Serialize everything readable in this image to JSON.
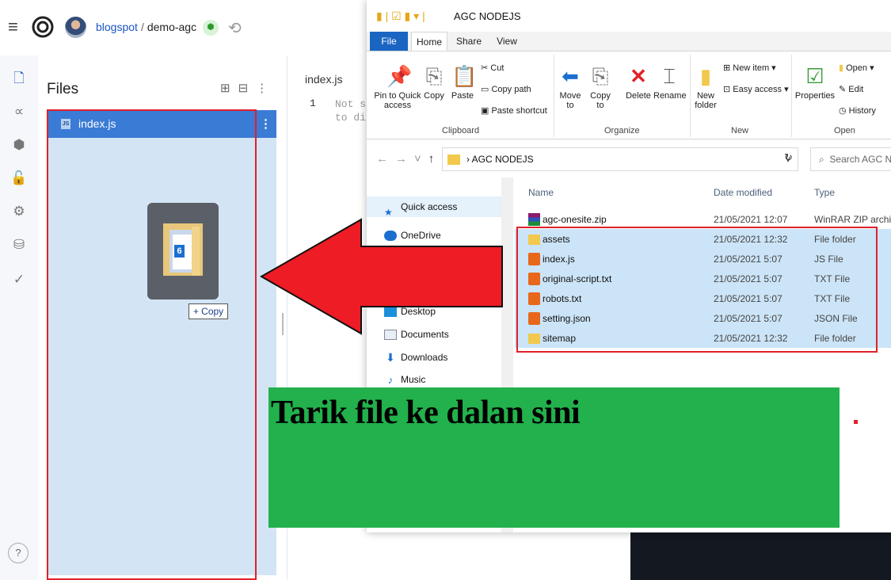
{
  "ide": {
    "breadcrumb_user": "blogspot",
    "breadcrumb_sep": "/",
    "breadcrumb_project": "demo-agc",
    "files_title": "Files",
    "file_name": "index.js",
    "js_badge": "JS",
    "editor_tab": "index.js",
    "line_number": "1",
    "editor_placeholder": "Not su\nto dis",
    "help": "?"
  },
  "drag": {
    "count": "6",
    "copy_label": "+ Copy"
  },
  "explorer": {
    "title": "AGC NODEJS",
    "tabs": [
      "File",
      "Home",
      "Share",
      "View"
    ],
    "ribbon": {
      "pin_label": "Pin to Quick access",
      "copy": "Copy",
      "paste": "Paste",
      "cut": "Cut",
      "copy_path": "Copy path",
      "paste_shortcut": "Paste shortcut",
      "move_to": "Move to",
      "copy_to": "Copy to",
      "delete": "Delete",
      "rename": "Rename",
      "new_folder": "New folder",
      "new_item": "New item",
      "easy_access": "Easy access",
      "properties": "Properties",
      "open": "Open",
      "edit": "Edit",
      "history": "History",
      "groups": [
        "Clipboard",
        "Organize",
        "New",
        "Open"
      ]
    },
    "address": "AGC NODEJS",
    "search_placeholder": "Search AGC N",
    "nav": [
      "Quick access",
      "OneDrive",
      "Desktop",
      "Documents",
      "Downloads",
      "Music"
    ],
    "columns": [
      "Name",
      "Date modified",
      "Type"
    ],
    "files": [
      {
        "name": "agc-onesite.zip",
        "date": "21/05/2021 12:07",
        "type": "WinRAR ZIP archive",
        "icon": "rar-icon",
        "selected": false
      },
      {
        "name": "assets",
        "date": "21/05/2021 12:32",
        "type": "File folder",
        "icon": "folder-icon",
        "selected": true
      },
      {
        "name": "index.js",
        "date": "21/05/2021 5:07",
        "type": "JS File",
        "icon": "sublime-file-icon",
        "selected": true
      },
      {
        "name": "original-script.txt",
        "date": "21/05/2021 5:07",
        "type": "TXT File",
        "icon": "sublime-file-icon",
        "selected": true
      },
      {
        "name": "robots.txt",
        "date": "21/05/2021 5:07",
        "type": "TXT File",
        "icon": "sublime-file-icon",
        "selected": true
      },
      {
        "name": "setting.json",
        "date": "21/05/2021 5:07",
        "type": "JSON File",
        "icon": "sublime-file-icon",
        "selected": true
      },
      {
        "name": "sitemap",
        "date": "21/05/2021 12:32",
        "type": "File folder",
        "icon": "folder-icon",
        "selected": true
      }
    ]
  },
  "annotation": {
    "banner_text": "Tarik file ke dalan sini",
    "banner_color": "#22b14c",
    "highlight_color": "#e0202a"
  }
}
